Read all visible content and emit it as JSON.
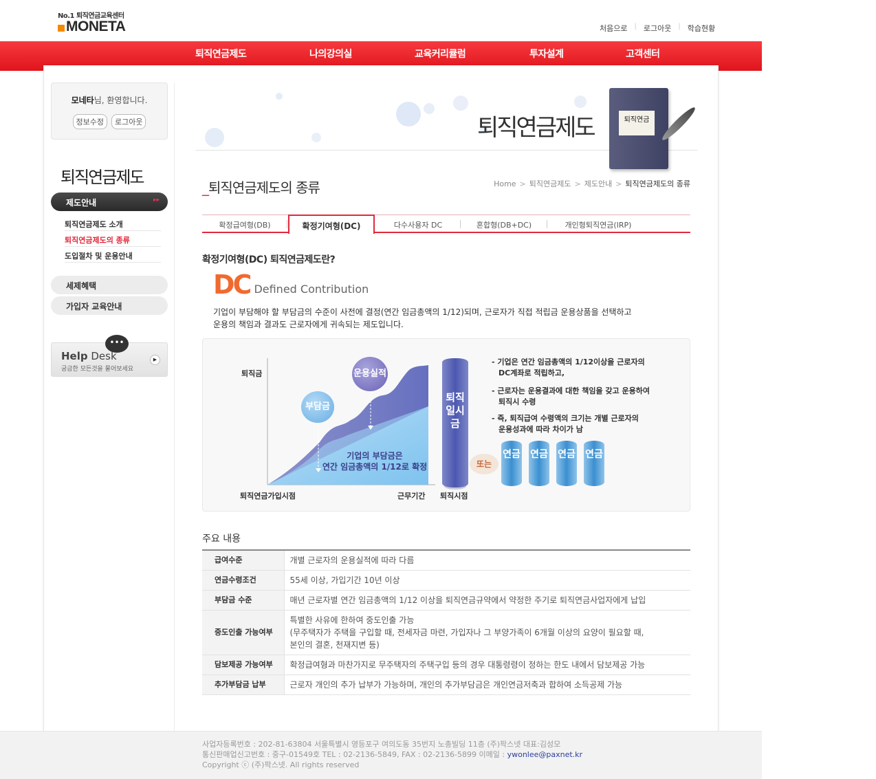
{
  "header": {
    "logo_tag": "No.1 퇴직연금교육센터",
    "logo_word": "MONETA",
    "util": [
      "처음으로",
      "로그아웃",
      "학습현황"
    ]
  },
  "gnb": [
    "퇴직연금제도",
    "나의강의실",
    "교육커리큘럼",
    "투자설계",
    "고객센터"
  ],
  "sidebar": {
    "user": "모네타",
    "greeting": "님, 환영합니다.",
    "edit_btn": "정보수정",
    "logout_btn": "로그아웃",
    "title": "퇴직연금제도",
    "active": "제도안내",
    "sub": [
      "퇴직연금제도 소개",
      "퇴직연금제도의 종류",
      "도입절차 및 운용안내"
    ],
    "pills": [
      "세제혜택",
      "가입자 교육안내"
    ],
    "help_title_a": "Help",
    "help_title_b": " Desk",
    "help_sub": "궁금한 모든것을 물어보세요"
  },
  "banner": {
    "title": "퇴직연금제도",
    "book_label": "퇴직연금"
  },
  "page": {
    "title": "퇴직연금제도의 종류",
    "breadcrumb": [
      "Home",
      "퇴직연금제도",
      "제도안내",
      "퇴직연금제도의 종류"
    ]
  },
  "tabs": [
    "확정급여형(DB)",
    "확정기여형(DC)",
    "다수사용자 DC",
    "혼합형(DB+DC)",
    "개인형퇴직연금(IRP)"
  ],
  "section": {
    "heading": "확정기여형(DC) 퇴직연금제도란?",
    "dc": "DC",
    "dc_full": "Defined Contribution",
    "desc1": "기업이 부담해야 할 부담금의 수준이 사전에 결정(연간 임금총액의 1/12)되며, 근로자가 직접 적립금 운용상품을 선택하고",
    "desc2": "운용의 책임과 결과도 근로자에게 귀속되는 제도입니다."
  },
  "diagram": {
    "y_label": "퇴직금",
    "x_start": "퇴직연금가입시점",
    "x_mid": "근무기간",
    "x_end": "퇴직시점",
    "bubble_a": "부담금",
    "bubble_b": "운용실적",
    "area_text1": "기업의 부담금은",
    "area_text2": "연간 임금총액의 1/12로 확정",
    "lump": "퇴직일시금",
    "or": "또는",
    "pension": "연금",
    "notes": [
      [
        "- 기업은 연간 임금총액의 1/12이상을 근로자의",
        "DC계좌로 적립하고,"
      ],
      [
        "- 근로자는 운용결과에 대한 책임을 갖고 운용하여",
        "퇴직시 수령"
      ],
      [
        "- 즉, 퇴직급여 수령액의 크기는 개별 근로자의",
        "운용성과에 따라 차이가 남"
      ]
    ]
  },
  "table": {
    "heading": "주요 내용",
    "rows": [
      {
        "k": "급여수준",
        "v": "개별 근로자의 운용실적에 따라 다름"
      },
      {
        "k": "연금수령조건",
        "v": "55세 이상, 가입기간 10년 이상"
      },
      {
        "k": "부담금 수준",
        "v": "매년 근로자별 연간 임금총액의 1/12 이상을 퇴직연금규약에서 약정한 주기로 퇴직연금사업자에게 납입"
      },
      {
        "k": "중도인출 가능여부",
        "v1": "특별한 사유에 한하여 중도인출 가능",
        "v2": "(무주택자가 주택을 구입할 때, 전세자금 마련, 가입자나 그 부양가족이 6개월 이상의 요양이 필요할 때,",
        "v3": "본인의 결혼, 천재지변 등)"
      },
      {
        "k": "담보제공 가능여부",
        "v": "확정급여형과 마찬가지로 무주택자의 주택구입 등의 경우 대통령령이 정하는 한도 내에서 담보제공 가능"
      },
      {
        "k": "추가부담금 납부",
        "v": "근로자 개인의 추가 납부가 가능하며, 개인의 추가부담금은 개인연금저축과 합하여 소득공제 가능"
      }
    ]
  },
  "footer": {
    "line1": "사업자등록번호 : 202-81-63804 서울특별시 영등포구 여의도동 35번지 노총빌딩 11층 (주)팍스넷 대표:김성모",
    "line2": "통신판매업신고번호 : 중구-01549호 TEL : 02-2136-5849, FAX : 02-2136-5899 이메일 : ",
    "email": "ywonlee@paxnet.kr",
    "line3": "Copyright ⓒ (주)팍스넷. All rights reserved"
  },
  "colors": {
    "accent": "#e0283b",
    "gnb": "#f0262d",
    "dc_orange": "#f06a30"
  }
}
